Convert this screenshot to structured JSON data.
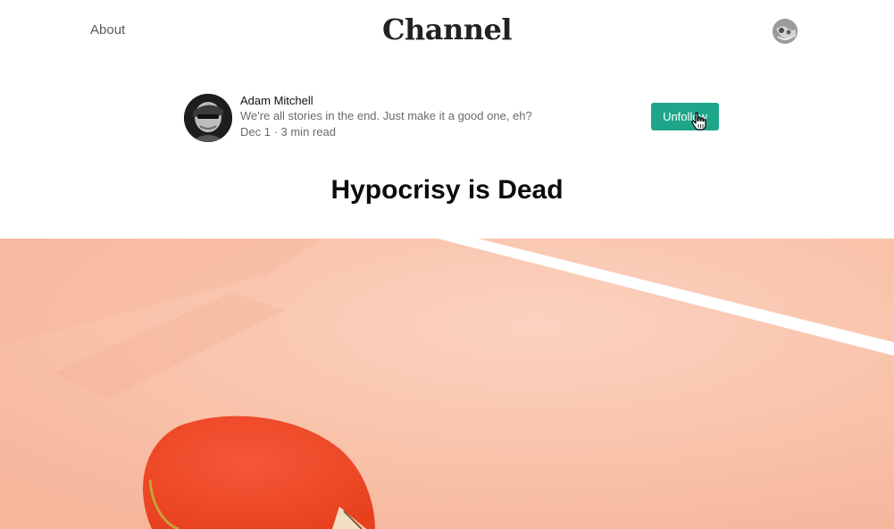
{
  "nav": {
    "about_label": "About",
    "brand": "Channel",
    "user_avatar_icon": "user-avatar-icon"
  },
  "author": {
    "name": "Adam Mitchell",
    "bio": "We're all stories in the end. Just make it a good one, eh?",
    "meta": "Dec 1 · 3 min read",
    "follow_label": "Unfollow",
    "follow_color": "#1fa589"
  },
  "article": {
    "title": "Hypocrisy is Dead"
  },
  "colors": {
    "hero_background": "#f9c0a7",
    "paddle": "#f24a2a",
    "table_line": "#ffffff"
  }
}
